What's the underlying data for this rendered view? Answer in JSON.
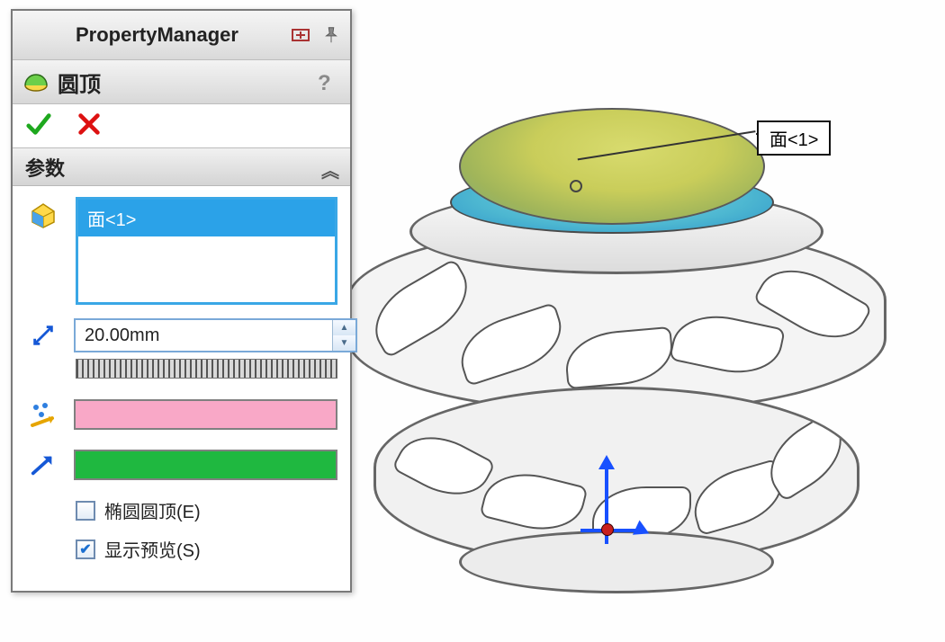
{
  "panel": {
    "title": "PropertyManager",
    "feature_name": "圆顶",
    "section_title": "参数",
    "selection_item": "面<1>",
    "distance_value": "20.00mm",
    "ellipse_label": "椭圆圆顶(E)",
    "preview_label": "显示预览(S)",
    "ellipse_checked": false,
    "preview_checked": true,
    "color1": "#f9a8c7",
    "color2": "#1fb840"
  },
  "callout": {
    "label": "面<1>"
  },
  "icons": {
    "keepvisible": "keep-visible-icon",
    "pin": "pin-icon",
    "dome": "dome-feature-icon",
    "help": "?",
    "ok": "ok-icon",
    "cancel": "cancel-icon",
    "face": "face-select-icon",
    "distance": "distance-icon",
    "sketch": "sketch-color-icon",
    "direction": "direction-arrow-icon",
    "collapse": "︽"
  }
}
